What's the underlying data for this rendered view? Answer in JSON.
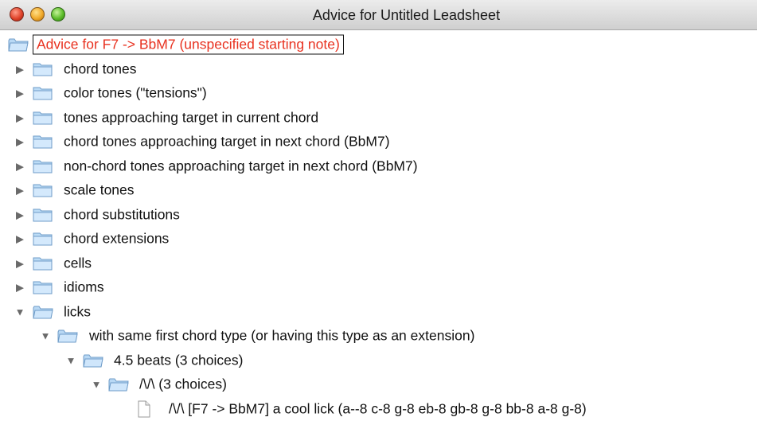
{
  "window": {
    "title": "Advice for Untitled Leadsheet"
  },
  "tree": {
    "root": "Advice for F7 -> BbM7 (unspecified starting note)",
    "categories": [
      "chord tones",
      "color tones (\"tensions\")",
      "tones approaching target in current chord",
      "chord tones approaching target in next chord (BbM7)",
      "non-chord tones approaching target in next chord (BbM7)",
      "scale tones",
      "chord substitutions",
      "chord extensions",
      "cells",
      "idioms",
      "licks"
    ],
    "licks_child": "with same first chord type (or having this type as an extension)",
    "beats_node": "4.5 beats  (3 choices)",
    "contour_node": "/\\/\\ (3 choices)",
    "leaf": "/\\/\\  [F7 -> BbM7]  a cool lick (a--8 c-8 g-8 eb-8 gb-8 g-8 bb-8 a-8 g-8)"
  }
}
